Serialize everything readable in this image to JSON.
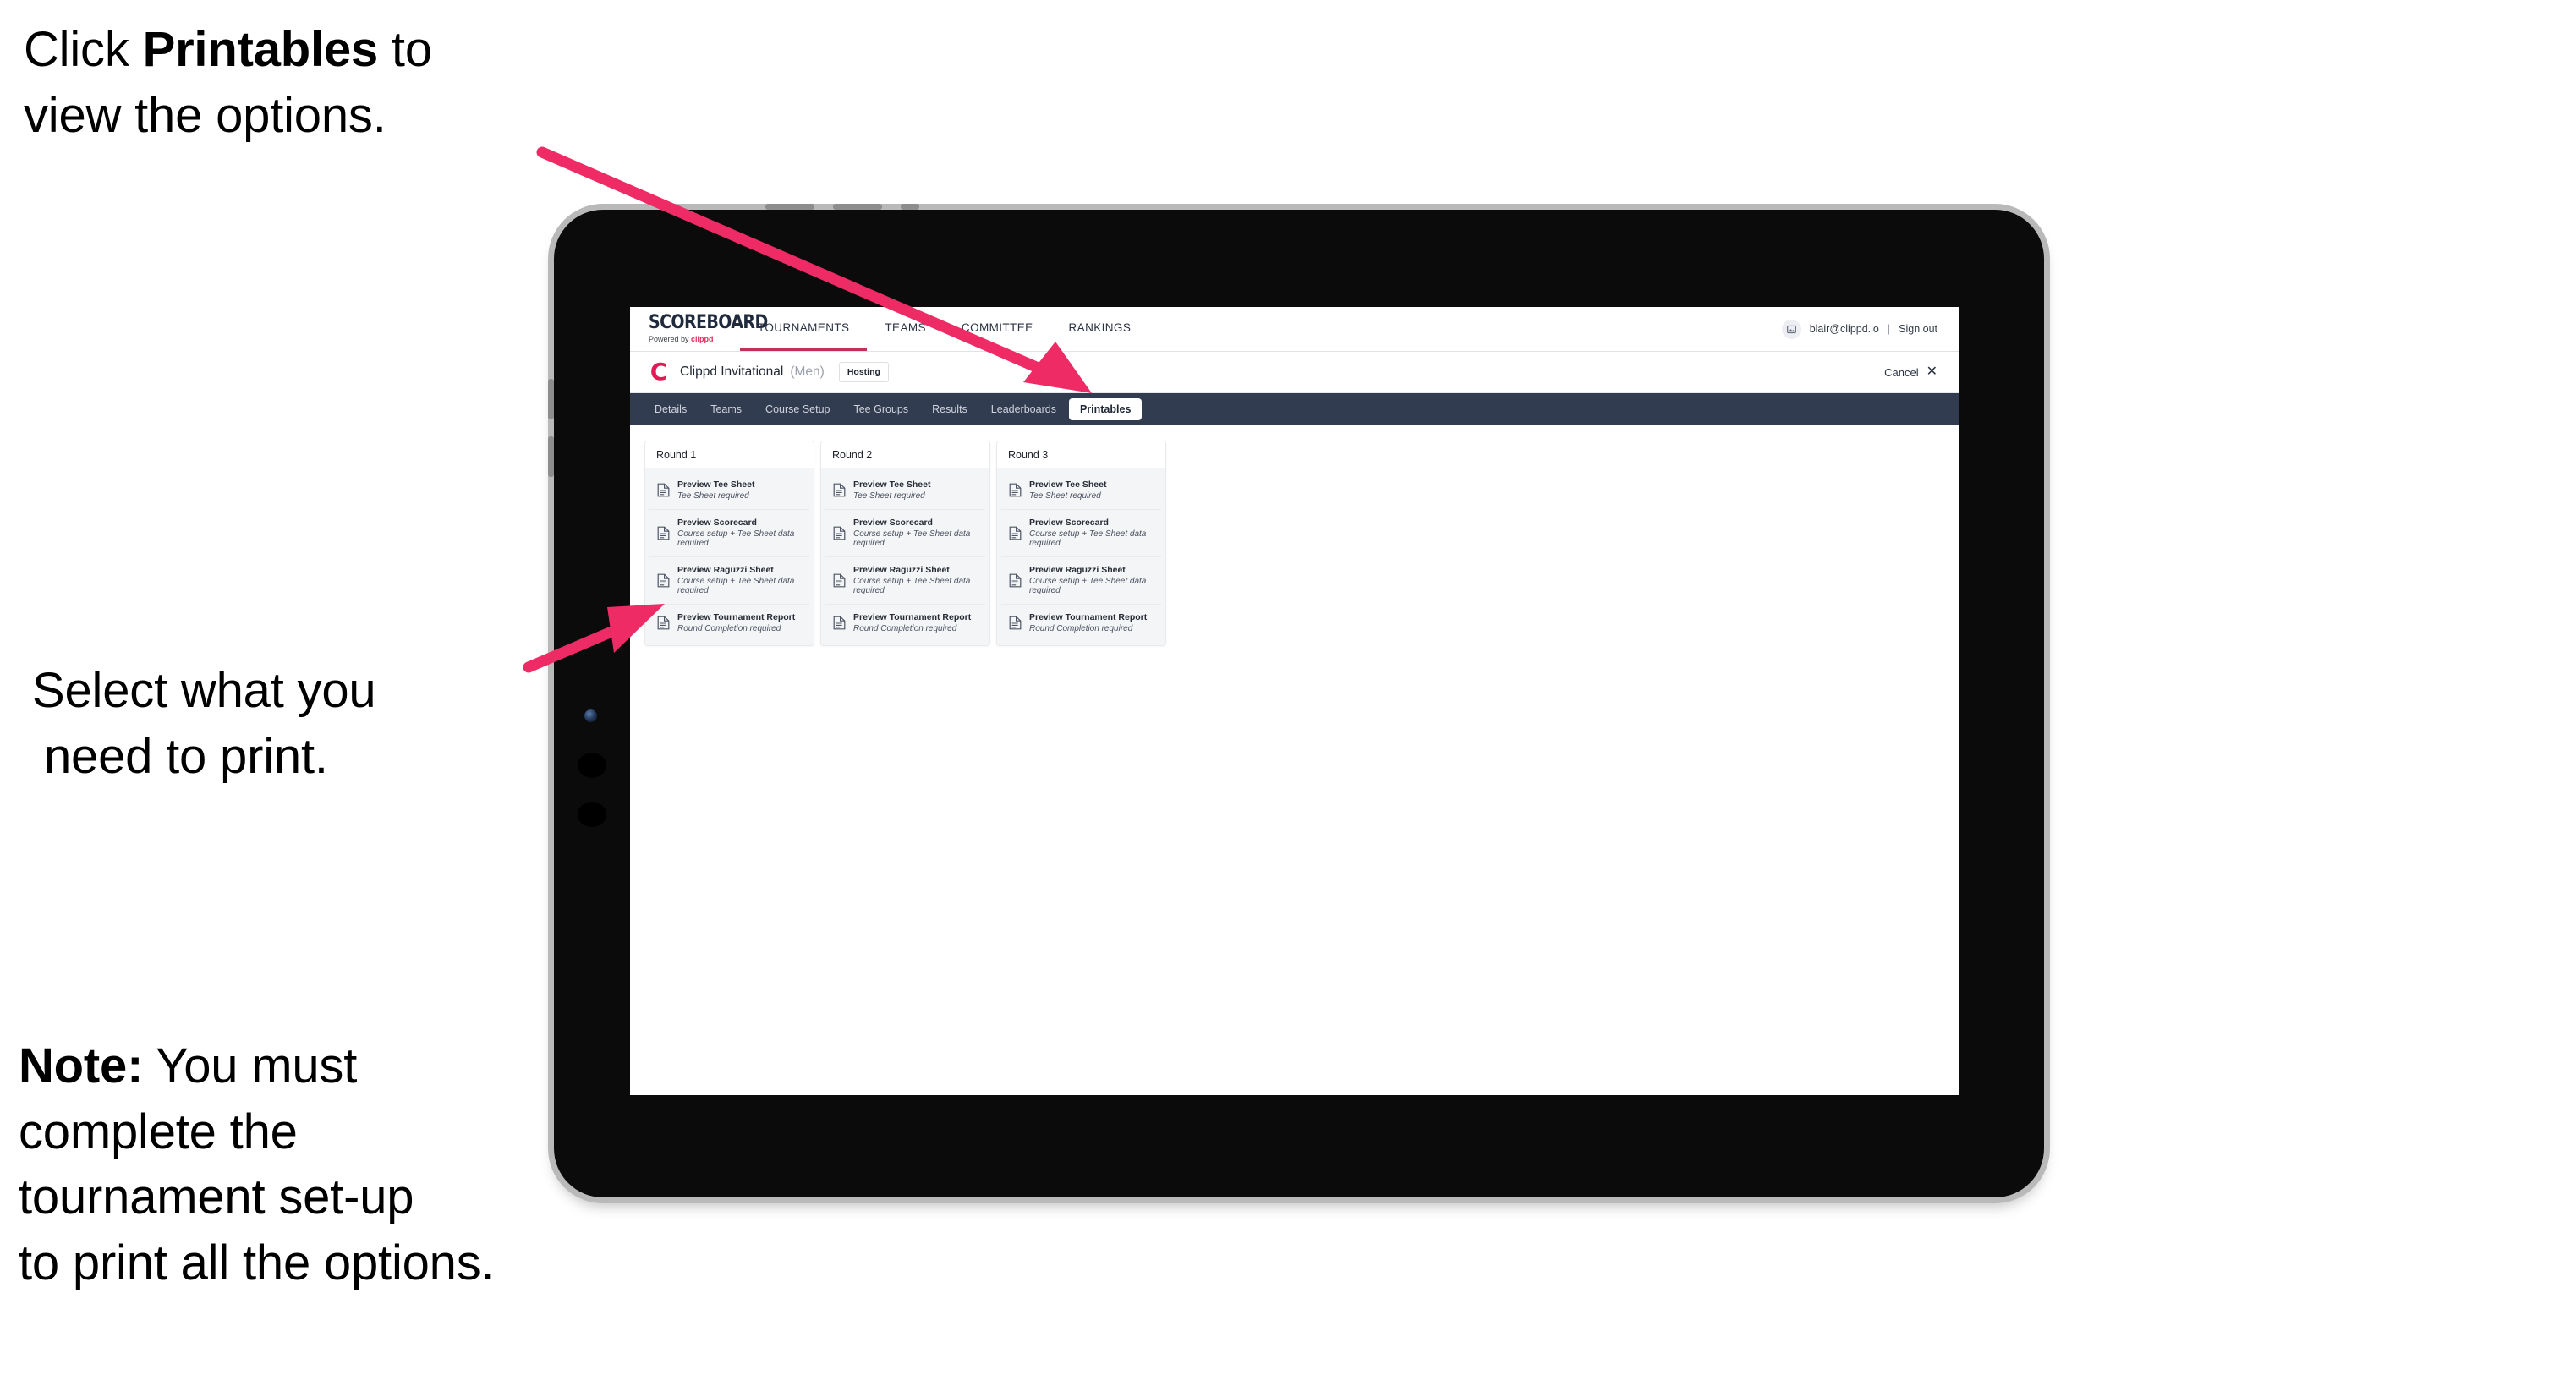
{
  "annotations": {
    "callout1": {
      "prefix": "Click ",
      "bold": "Printables",
      "suffix": " to",
      "line2": "view the options."
    },
    "callout2": {
      "line1": "Select what you",
      "line2": "need to print."
    },
    "callout3": {
      "bold": "Note:",
      "rest": " You must",
      "line2": "complete the",
      "line3": "tournament set-up",
      "line4": "to print all the options."
    },
    "arrow_color": "#EE2B64"
  },
  "app": {
    "brand": {
      "wordmark": "SCOREBOARD",
      "tagline_pre": "Powered by ",
      "tagline_brand": "clippd"
    },
    "nav": [
      {
        "label": "TOURNAMENTS",
        "active": true
      },
      {
        "label": "TEAMS",
        "active": false
      },
      {
        "label": "COMMITTEE",
        "active": false
      },
      {
        "label": "RANKINGS",
        "active": false
      }
    ],
    "account": {
      "avatar_icon": "user-image-icon",
      "email": "blair@clippd.io",
      "separator": "|",
      "sign_out": "Sign out"
    },
    "tournament": {
      "logo_letter": "C",
      "name": "Clippd Invitational",
      "gender": "(Men)",
      "badge": "Hosting",
      "cancel_label": "Cancel",
      "cancel_icon": "close-icon"
    },
    "subnav": [
      {
        "label": "Details",
        "active": false
      },
      {
        "label": "Teams",
        "active": false
      },
      {
        "label": "Course Setup",
        "active": false
      },
      {
        "label": "Tee Groups",
        "active": false
      },
      {
        "label": "Results",
        "active": false
      },
      {
        "label": "Leaderboards",
        "active": false
      },
      {
        "label": "Printables",
        "active": true
      }
    ],
    "rounds": [
      {
        "title": "Round 1",
        "items": [
          {
            "title": "Preview Tee Sheet",
            "sub": "Tee Sheet required"
          },
          {
            "title": "Preview Scorecard",
            "sub": "Course setup + Tee Sheet data required"
          },
          {
            "title": "Preview Raguzzi Sheet",
            "sub": "Course setup + Tee Sheet data required"
          },
          {
            "title": "Preview Tournament Report",
            "sub": "Round Completion required"
          }
        ]
      },
      {
        "title": "Round 2",
        "items": [
          {
            "title": "Preview Tee Sheet",
            "sub": "Tee Sheet required"
          },
          {
            "title": "Preview Scorecard",
            "sub": "Course setup + Tee Sheet data required"
          },
          {
            "title": "Preview Raguzzi Sheet",
            "sub": "Course setup + Tee Sheet data required"
          },
          {
            "title": "Preview Tournament Report",
            "sub": "Round Completion required"
          }
        ]
      },
      {
        "title": "Round 3",
        "items": [
          {
            "title": "Preview Tee Sheet",
            "sub": "Tee Sheet required"
          },
          {
            "title": "Preview Scorecard",
            "sub": "Course setup + Tee Sheet data required"
          },
          {
            "title": "Preview Raguzzi Sheet",
            "sub": "Course setup + Tee Sheet data required"
          },
          {
            "title": "Preview Tournament Report",
            "sub": "Round Completion required"
          }
        ]
      }
    ]
  },
  "colors": {
    "accent_pink": "#E8285C",
    "subnav_bg": "#323C50",
    "nav_active_underline": "#C0315A",
    "card_body": "#F4F5F7"
  }
}
